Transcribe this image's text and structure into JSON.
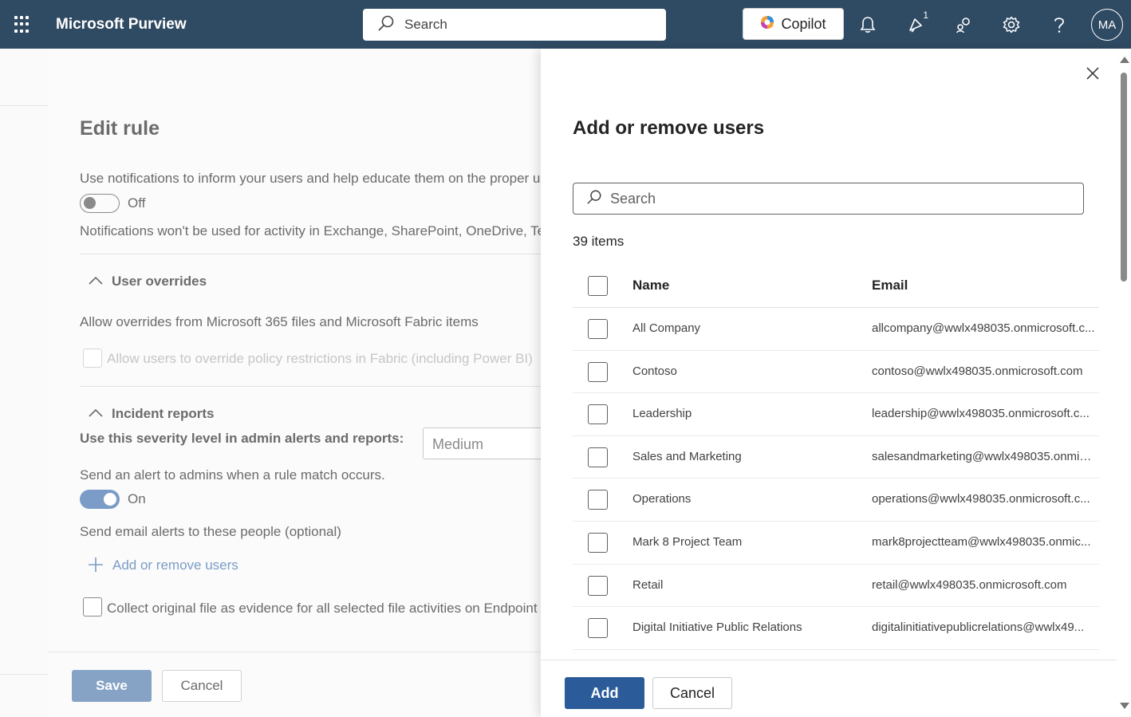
{
  "header": {
    "app_name": "Microsoft Purview",
    "search_placeholder": "Search",
    "copilot_label": "Copilot",
    "notification_badge": "1",
    "avatar_initials": "MA"
  },
  "edit_rule": {
    "title": "Edit rule",
    "notifications_text": "Use notifications to inform your users and help educate them on the proper use of sensitive info.",
    "notifications_toggle_label": "Off",
    "notifications_note": "Notifications won't be used for activity in Exchange, SharePoint, OneDrive, Teams",
    "user_overrides_heading": "User overrides",
    "allow_overrides_text": "Allow overrides from Microsoft 365 files and Microsoft Fabric items",
    "allow_users_override_label": "Allow users to override policy restrictions in Fabric (including Power BI)",
    "incident_reports_heading": "Incident reports",
    "severity_label": "Use this severity level in admin alerts and reports:",
    "severity_value": "Medium",
    "send_alert_text": "Send an alert to admins when a rule match occurs.",
    "send_alert_toggle_label": "On",
    "email_alerts_text": "Send email alerts to these people (optional)",
    "add_remove_users_link": "Add or remove users",
    "collect_evidence_label": "Collect original file as evidence for all selected file activities on Endpoint",
    "save_label": "Save",
    "cancel_label": "Cancel"
  },
  "flyout": {
    "title": "Add or remove users",
    "search_placeholder": "Search",
    "items_count": "39 items",
    "columns": {
      "name": "Name",
      "email": "Email"
    },
    "rows": [
      {
        "name": "All Company",
        "email": "allcompany@wwlx498035.onmicrosoft.c..."
      },
      {
        "name": "Contoso",
        "email": "contoso@wwlx498035.onmicrosoft.com"
      },
      {
        "name": "Leadership",
        "email": "leadership@wwlx498035.onmicrosoft.c..."
      },
      {
        "name": "Sales and Marketing",
        "email": "salesandmarketing@wwlx498035.onmic..."
      },
      {
        "name": "Operations",
        "email": "operations@wwlx498035.onmicrosoft.c..."
      },
      {
        "name": "Mark 8 Project Team",
        "email": "mark8projectteam@wwlx498035.onmic..."
      },
      {
        "name": "Retail",
        "email": "retail@wwlx498035.onmicrosoft.com"
      },
      {
        "name": "Digital Initiative Public Relations",
        "email": "digitalinitiativepublicrelations@wwlx49..."
      }
    ],
    "add_label": "Add",
    "cancel_label": "Cancel"
  },
  "colors": {
    "header_bg": "#2f4a63",
    "primary_button": "#2b5c99",
    "toggle_on": "#7a9cc6"
  }
}
